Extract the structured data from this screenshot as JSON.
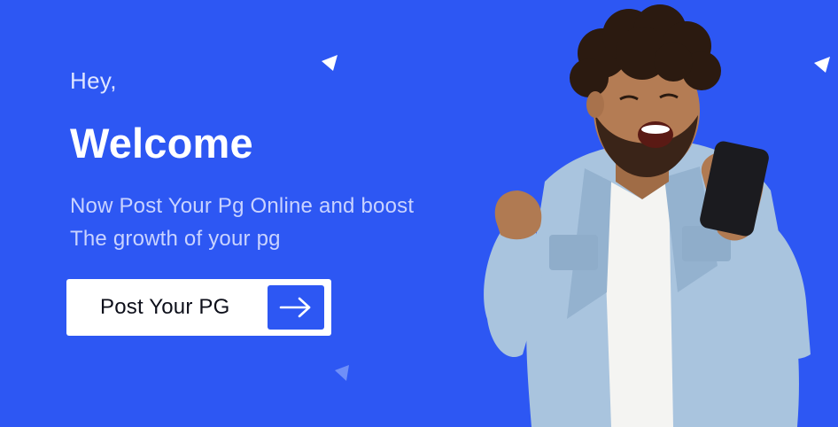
{
  "hero": {
    "greeting": "Hey,",
    "title": "Welcome",
    "subtitle_line1": "Now Post Your Pg Online and boost",
    "subtitle_line2": "The growth of your pg"
  },
  "cta": {
    "label": "Post Your PG",
    "icon": "arrow-right-icon"
  },
  "colors": {
    "background": "#2d57f3",
    "button_bg": "#ffffff",
    "button_arrow_bg": "#2d57f3",
    "text_primary": "#ffffff"
  },
  "illustration": {
    "icon": "celebrating-person-with-phone"
  }
}
